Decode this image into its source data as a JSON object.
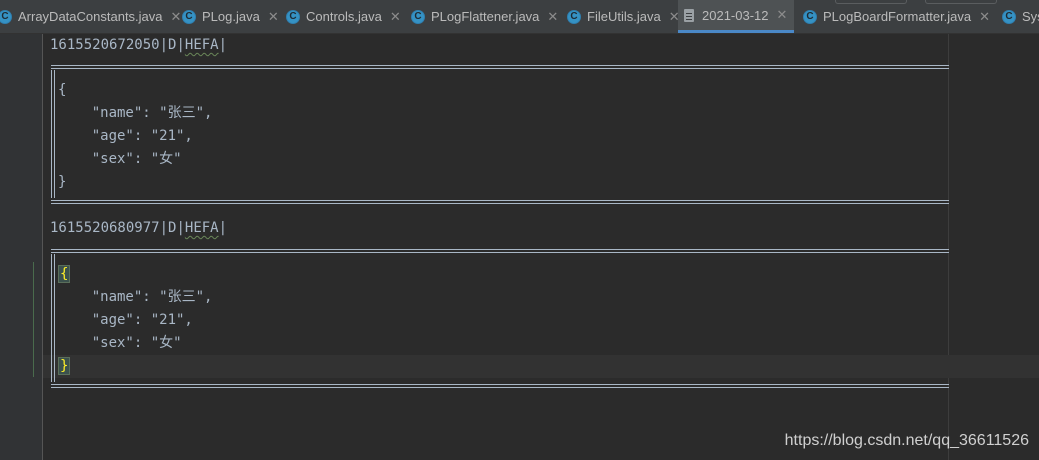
{
  "tabs": [
    {
      "label": "ArrayDataConstants.java",
      "icon": "java-class-icon"
    },
    {
      "label": "PLog.java",
      "icon": "java-class-icon"
    },
    {
      "label": "Controls.java",
      "icon": "java-class-icon"
    },
    {
      "label": "PLogFlattener.java",
      "icon": "java-class-icon"
    },
    {
      "label": "FileUtils.java",
      "icon": "java-class-icon"
    },
    {
      "label": "2021-03-12",
      "icon": "text-file-icon",
      "active": true
    },
    {
      "label": "PLogBoardFormatter.java",
      "icon": "java-class-icon"
    },
    {
      "label": "Syst",
      "icon": "java-class-icon"
    }
  ],
  "close_glyph": "✕",
  "entries": [
    {
      "header_time": "1615520672050",
      "header_level": "D",
      "header_tag": "HEFA",
      "sep": "|",
      "open_brace": "{",
      "lines": [
        "    \"name\": \"张三\",",
        "    \"age\": \"21\",",
        "    \"sex\": \"女\""
      ],
      "close_brace": "}"
    },
    {
      "header_time": "1615520680977",
      "header_level": "D",
      "header_tag": "HEFA",
      "sep": "|",
      "open_brace": "{",
      "lines": [
        "    \"name\": \"张三\",",
        "    \"age\": \"21\",",
        "    \"sex\": \"女\""
      ],
      "close_brace": "}"
    }
  ],
  "watermark": "https://blog.csdn.net/qq_36611526",
  "colors": {
    "background": "#2b2b2b",
    "text": "#a9b7c6",
    "brace_highlight": "#ffef28",
    "active_tab_underline": "#4a88c7"
  }
}
